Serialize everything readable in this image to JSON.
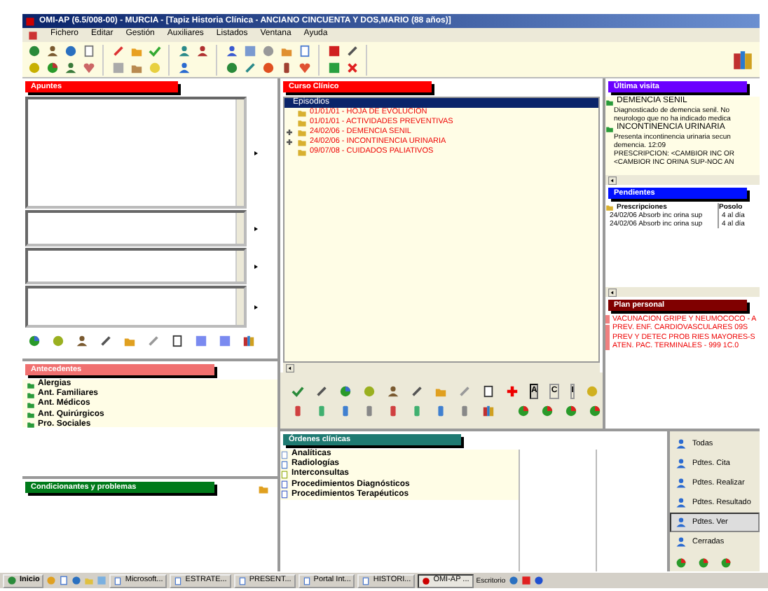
{
  "window": {
    "title": "OMI-AP (6.5/008-00) - MURCIA - [Tapiz Historia Clínica - ANCIANO CINCUENTA Y DOS,MARIO (88 años)]"
  },
  "menu": [
    "Fichero",
    "Editar",
    "Gestión",
    "Auxiliares",
    "Listados",
    "Ventana",
    "Ayuda"
  ],
  "apuntes": {
    "title": "Apuntes"
  },
  "curso": {
    "title": "Curso Clínico",
    "header": "Episodios",
    "episodes": [
      {
        "label": "01/01/01 - HOJA DE EVOLUCION",
        "expandable": false
      },
      {
        "label": "01/01/01 - ACTIVIDADES PREVENTIVAS",
        "expandable": false
      },
      {
        "label": "24/02/06 - DEMENCIA SENIL",
        "expandable": true
      },
      {
        "label": "24/02/06 - INCONTINENCIA URINARIA",
        "expandable": true
      },
      {
        "label": "09/07/08 - CUIDADOS PALIATIVOS",
        "expandable": false
      }
    ]
  },
  "ultima_visita": {
    "title": "Última visita",
    "entries": [
      {
        "heading": "DEMENCIA SENIL",
        "lines": [
          "Diagnosticado de demencia senil. No",
          "neurologo que no ha indicado medica"
        ]
      },
      {
        "heading": "INCONTINENCIA URINARIA",
        "lines": [
          "Presenta incontinencia urinaria secun",
          "demencia. 12:09",
          "PRESCRIPCION: <CAMBIOR INC OR",
          "<CAMBIOR INC ORINA SUP-NOC AN"
        ]
      }
    ]
  },
  "pendientes": {
    "title": "Pendientes",
    "columns": [
      "Prescripciones",
      "Posolo"
    ],
    "rows": [
      [
        "24/02/06 Absorb inc orina sup",
        "4 al día"
      ],
      [
        "24/02/06 Absorb inc orina sup",
        "4 al día"
      ]
    ]
  },
  "plan": {
    "title": "Plan personal",
    "items": [
      "VACUNACION GRIPE Y NEUMOCOCO - A",
      "PREV. ENF. CARDIOVASCULARES 09S",
      "PREV Y DETEC PROB RIES MAYORES-S",
      "ATEN. PAC. TERMINALES - 999 1C.0"
    ]
  },
  "antecedentes": {
    "title": "Antecedentes",
    "items": [
      "Alergias",
      "Ant. Familiares",
      "Ant. Médicos",
      "Ant. Quirúrgicos",
      "Pro. Sociales"
    ]
  },
  "tool_letters": [
    {
      "label": "A",
      "selected": true
    },
    {
      "label": "C",
      "selected": false
    },
    {
      "label": "I",
      "selected": false
    }
  ],
  "condicionantes": {
    "title": "Condicionantes y problemas"
  },
  "ordenes": {
    "title": "Órdenes clínicas",
    "items": [
      "Analíticas",
      "Radiologías",
      "Interconsultas",
      "Procedimientos Diagnósticos",
      "Procedimientos Terapéuticos"
    ]
  },
  "filter_buttons": [
    {
      "label": "Todas",
      "selected": false
    },
    {
      "label": "Pdtes. Cita",
      "selected": false
    },
    {
      "label": "Pdtes. Realizar",
      "selected": false
    },
    {
      "label": "Pdtes. Resultado",
      "selected": false
    },
    {
      "label": "Pdtes. Ver",
      "selected": true
    },
    {
      "label": "Cerradas",
      "selected": false
    }
  ],
  "taskbar": {
    "start": "Inicio",
    "tasks": [
      {
        "label": "Microsoft...",
        "selected": false
      },
      {
        "label": "ESTRATE...",
        "selected": false
      },
      {
        "label": "PRESENT...",
        "selected": false
      },
      {
        "label": "Portal Int...",
        "selected": false
      },
      {
        "label": "HISTORI...",
        "selected": false
      },
      {
        "label": "OMI-AP ...",
        "selected": true
      }
    ],
    "tray": "Escritorio"
  }
}
